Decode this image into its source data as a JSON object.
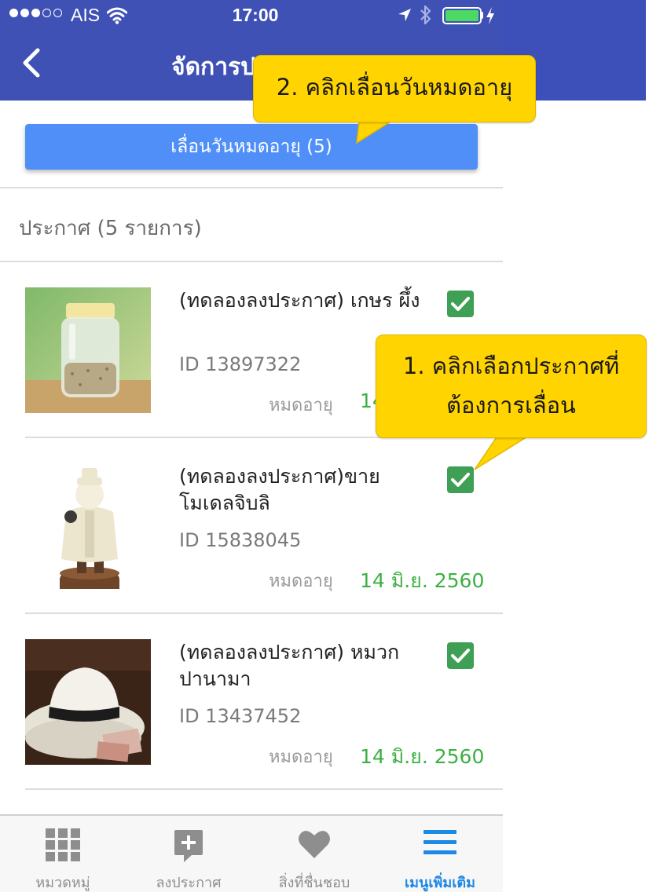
{
  "status_bar": {
    "carrier": "AIS",
    "time": "17:00",
    "signal_bars_filled": 3,
    "signal_bars_total": 5,
    "battery_level": 1.0
  },
  "header": {
    "title": "จัดการป",
    "back_icon": "chevron-left-icon"
  },
  "extend_button": {
    "label": "เลื่อนวันหมดอายุ (5)"
  },
  "section": {
    "title": "ประกาศ (5 รายการ)"
  },
  "listings": [
    {
      "title": "(ทดลองลงประกาศ) เกษร ผึ้ง",
      "id": "ID 13897322",
      "expiry_label": "หมดอายุ",
      "expiry_date": "14",
      "checked": true
    },
    {
      "title": "(ทดลองลงประกาศ)ขาย โมเดลจิบลิ",
      "id": "ID 15838045",
      "expiry_label": "หมดอายุ",
      "expiry_date": "14 มิ.ย. 2560",
      "checked": true
    },
    {
      "title": "(ทดลองลงประกาศ) หมวก ปานามา",
      "id": "ID 13437452",
      "expiry_label": "หมดอายุ",
      "expiry_date": "14 มิ.ย. 2560",
      "checked": true
    }
  ],
  "tabs": [
    {
      "label": "หมวดหมู่",
      "icon": "grid-icon",
      "active": false
    },
    {
      "label": "ลงประกาศ",
      "icon": "add-post-icon",
      "active": false
    },
    {
      "label": "สิ่งที่ชื่นชอบ",
      "icon": "heart-icon",
      "active": false
    },
    {
      "label": "เมนูเพิ่มเติม",
      "icon": "menu-icon",
      "active": true
    }
  ],
  "callouts": [
    {
      "text_line1": "1. คลิกเลือกประกาศที่",
      "text_line2": "ต้องการเลื่อน"
    },
    {
      "text": "2. คลิกเลื่อนวันหมดอายุ"
    }
  ],
  "colors": {
    "header": "#3f51b5",
    "button": "#4f8ff7",
    "checkbox": "#3f9f55",
    "expiry_date": "#3cb043",
    "tab_active": "#1e88e5",
    "callout": "#ffd400"
  }
}
